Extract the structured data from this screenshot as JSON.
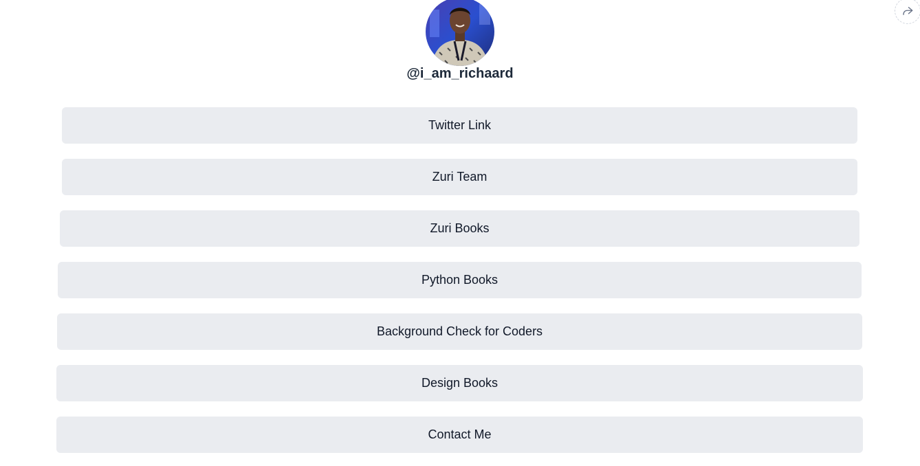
{
  "profile": {
    "username": "@i_am_richaard",
    "avatar_icon": "profile-photo"
  },
  "share": {
    "icon": "share-arrow-icon"
  },
  "links": [
    {
      "label": "Twitter Link"
    },
    {
      "label": "Zuri Team"
    },
    {
      "label": "Zuri Books"
    },
    {
      "label": "Python Books"
    },
    {
      "label": "Background Check for Coders"
    },
    {
      "label": "Design Books"
    },
    {
      "label": "Contact Me"
    }
  ],
  "colors": {
    "button_bg": "#eaecf0",
    "text": "#101828"
  }
}
